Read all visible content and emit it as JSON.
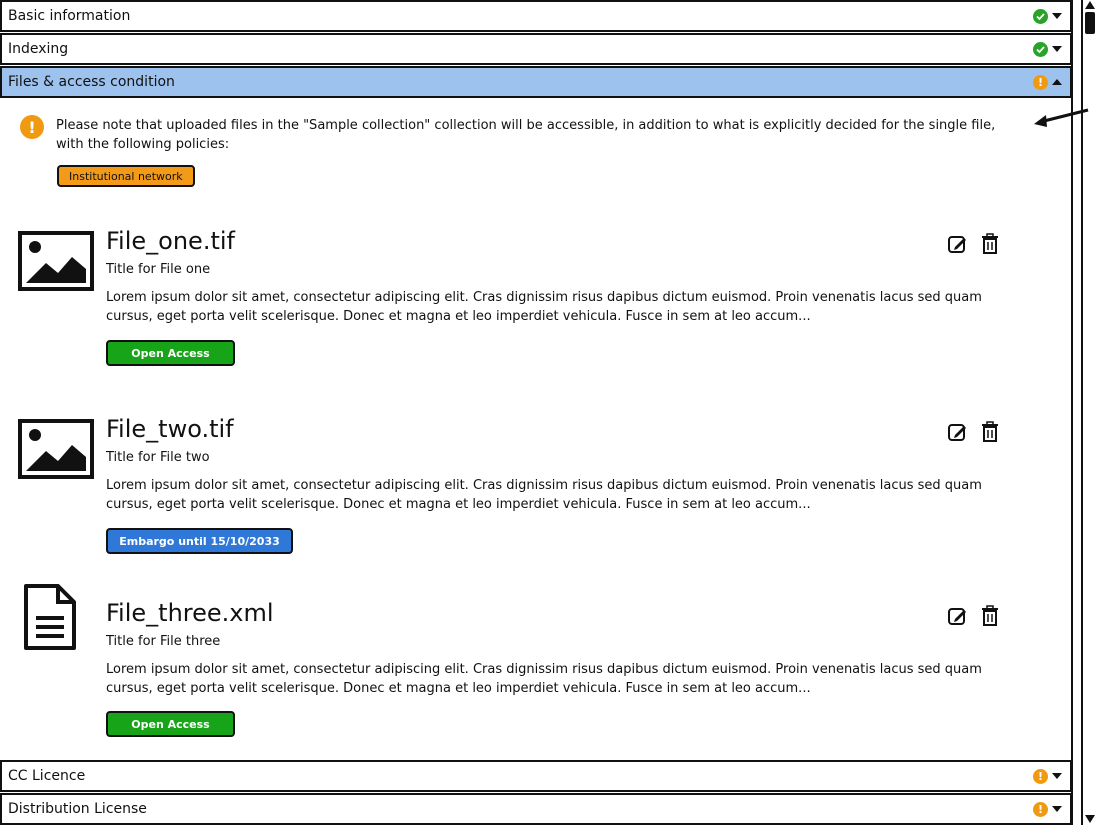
{
  "sections": {
    "basic": {
      "label": "Basic information",
      "status": "ok"
    },
    "indexing": {
      "label": "Indexing",
      "status": "ok"
    },
    "files": {
      "label": "Files & access condition",
      "status": "warning"
    },
    "cc": {
      "label": "CC Licence",
      "status": "warning"
    },
    "distribution": {
      "label": "Distribution License",
      "status": "warning"
    }
  },
  "notice": {
    "text": "Please note that uploaded files in the \"Sample collection\" collection will be accessible, in addition to what is explicitly decided for the single file, with the following policies:",
    "policy": "Institutional network"
  },
  "files": [
    {
      "name": "File_one.tif",
      "title": "Title for File one",
      "description": "Lorem ipsum dolor sit amet, consectetur adipiscing elit. Cras dignissim risus dapibus dictum euismod. Proin venenatis lacus sed quam cursus, eget porta velit scelerisque. Donec et magna et leo imperdiet vehicula. Fusce in sem at leo accum...",
      "access": "Open Access",
      "icon": "image-icon"
    },
    {
      "name": "File_two.tif",
      "title": "Title for File two",
      "description": "Lorem ipsum dolor sit amet, consectetur adipiscing elit. Cras dignissim risus dapibus dictum euismod. Proin venenatis lacus sed quam cursus, eget porta velit scelerisque. Donec et magna et leo imperdiet vehicula. Fusce in sem at leo accum...",
      "access": "Embargo until 15/10/2033",
      "icon": "image-icon"
    },
    {
      "name": "File_three.xml",
      "title": "Title for File three",
      "description": "Lorem ipsum dolor sit amet, consectetur adipiscing elit. Cras dignissim risus dapibus dictum euismod. Proin venenatis lacus sed quam cursus, eget porta velit scelerisque. Donec et magna et leo imperdiet vehicula. Fusce in sem at leo accum...",
      "access": "Open Access",
      "icon": "document-icon"
    }
  ],
  "colors": {
    "active_section": "#9ec2ee",
    "ok": "#28a428",
    "warning": "#f09a12",
    "open_access": "#18a418",
    "embargo": "#3078d8",
    "policy": "#f39a18"
  }
}
